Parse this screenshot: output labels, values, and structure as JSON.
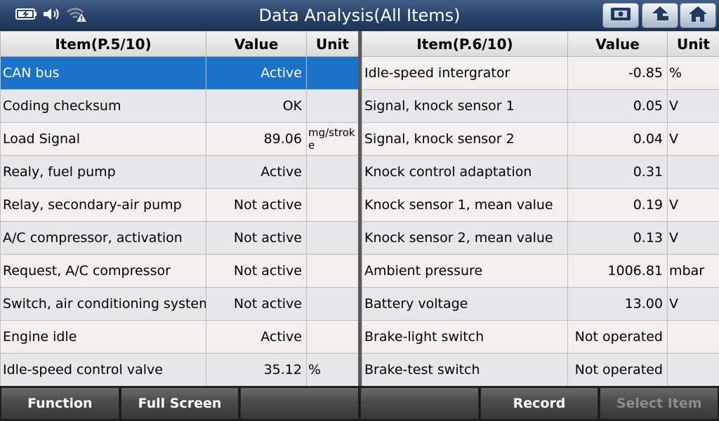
{
  "title": "Data Analysis(All Items)",
  "icons": {
    "battery": "battery-icon",
    "volume": "speaker-icon",
    "wifi": "wifi-warning-icon",
    "screenshot": "screenshot-icon",
    "back": "up-arrow-icon",
    "home": "home-icon"
  },
  "left_table": {
    "headers": {
      "item": "Item(P.5/10)",
      "value": "Value",
      "unit": "Unit"
    },
    "rows": [
      {
        "item": "CAN bus",
        "value": "Active",
        "unit": ""
      },
      {
        "item": "Coding checksum",
        "value": "OK",
        "unit": ""
      },
      {
        "item": "Load Signal",
        "value": "89.06",
        "unit": "mg/stroke"
      },
      {
        "item": "Realy, fuel pump",
        "value": "Active",
        "unit": ""
      },
      {
        "item": "Relay, secondary-air pump",
        "value": "Not active",
        "unit": ""
      },
      {
        "item": "A/C compressor, activation",
        "value": "Not active",
        "unit": ""
      },
      {
        "item": "Request, A/C compressor",
        "value": "Not active",
        "unit": ""
      },
      {
        "item": "Switch, air conditioning system",
        "value": "Not active",
        "unit": ""
      },
      {
        "item": "Engine idle",
        "value": "Active",
        "unit": ""
      },
      {
        "item": "Idle-speed control valve",
        "value": "35.12",
        "unit": "%"
      }
    ]
  },
  "right_table": {
    "headers": {
      "item": "Item(P.6/10)",
      "value": "Value",
      "unit": "Unit"
    },
    "rows": [
      {
        "item": "Idle-speed intergrator",
        "value": "-0.85",
        "unit": "%"
      },
      {
        "item": "Signal, knock sensor 1",
        "value": "0.05",
        "unit": "V"
      },
      {
        "item": "Signal, knock sensor 2",
        "value": "0.04",
        "unit": "V"
      },
      {
        "item": "Knock control adaptation",
        "value": "0.31",
        "unit": ""
      },
      {
        "item": "Knock sensor 1, mean value",
        "value": "0.19",
        "unit": "V"
      },
      {
        "item": "Knock sensor 2, mean value",
        "value": "0.13",
        "unit": "V"
      },
      {
        "item": "Ambient pressure",
        "value": "1006.81",
        "unit": "mbar"
      },
      {
        "item": "Battery voltage",
        "value": "13.00",
        "unit": "V"
      },
      {
        "item": "Brake-light switch",
        "value": "Not operated",
        "unit": ""
      },
      {
        "item": "Brake-test switch",
        "value": "Not operated",
        "unit": ""
      }
    ]
  },
  "bottom_bar": {
    "function": "Function",
    "full_screen": "Full Screen",
    "empty1": "",
    "empty2": "",
    "record": "Record",
    "select_item": "Select Item"
  }
}
